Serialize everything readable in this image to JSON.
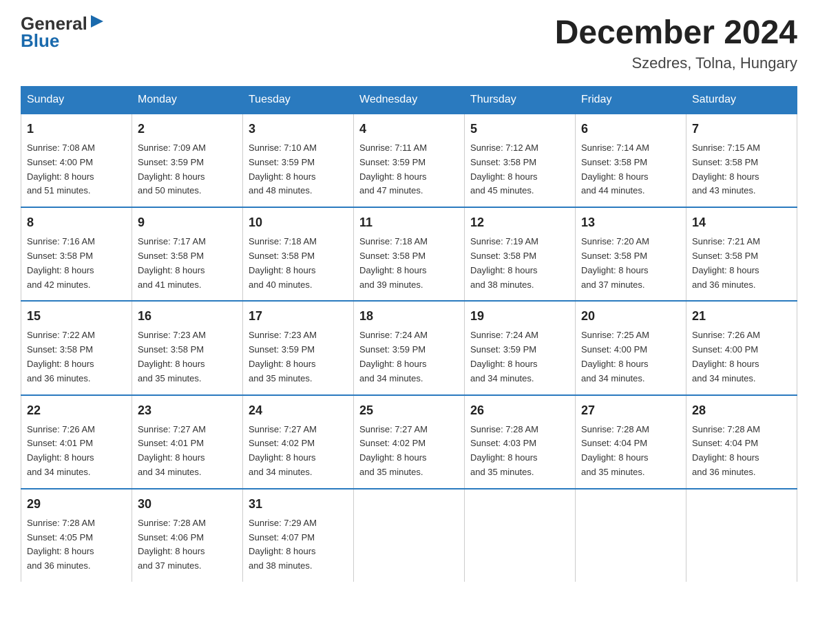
{
  "header": {
    "logo_text_general": "General",
    "logo_text_blue": "Blue",
    "month_title": "December 2024",
    "subtitle": "Szedres, Tolna, Hungary"
  },
  "days_of_week": [
    "Sunday",
    "Monday",
    "Tuesday",
    "Wednesday",
    "Thursday",
    "Friday",
    "Saturday"
  ],
  "weeks": [
    [
      {
        "day": "1",
        "sunrise": "7:08 AM",
        "sunset": "4:00 PM",
        "daylight": "8 hours and 51 minutes."
      },
      {
        "day": "2",
        "sunrise": "7:09 AM",
        "sunset": "3:59 PM",
        "daylight": "8 hours and 50 minutes."
      },
      {
        "day": "3",
        "sunrise": "7:10 AM",
        "sunset": "3:59 PM",
        "daylight": "8 hours and 48 minutes."
      },
      {
        "day": "4",
        "sunrise": "7:11 AM",
        "sunset": "3:59 PM",
        "daylight": "8 hours and 47 minutes."
      },
      {
        "day": "5",
        "sunrise": "7:12 AM",
        "sunset": "3:58 PM",
        "daylight": "8 hours and 45 minutes."
      },
      {
        "day": "6",
        "sunrise": "7:14 AM",
        "sunset": "3:58 PM",
        "daylight": "8 hours and 44 minutes."
      },
      {
        "day": "7",
        "sunrise": "7:15 AM",
        "sunset": "3:58 PM",
        "daylight": "8 hours and 43 minutes."
      }
    ],
    [
      {
        "day": "8",
        "sunrise": "7:16 AM",
        "sunset": "3:58 PM",
        "daylight": "8 hours and 42 minutes."
      },
      {
        "day": "9",
        "sunrise": "7:17 AM",
        "sunset": "3:58 PM",
        "daylight": "8 hours and 41 minutes."
      },
      {
        "day": "10",
        "sunrise": "7:18 AM",
        "sunset": "3:58 PM",
        "daylight": "8 hours and 40 minutes."
      },
      {
        "day": "11",
        "sunrise": "7:18 AM",
        "sunset": "3:58 PM",
        "daylight": "8 hours and 39 minutes."
      },
      {
        "day": "12",
        "sunrise": "7:19 AM",
        "sunset": "3:58 PM",
        "daylight": "8 hours and 38 minutes."
      },
      {
        "day": "13",
        "sunrise": "7:20 AM",
        "sunset": "3:58 PM",
        "daylight": "8 hours and 37 minutes."
      },
      {
        "day": "14",
        "sunrise": "7:21 AM",
        "sunset": "3:58 PM",
        "daylight": "8 hours and 36 minutes."
      }
    ],
    [
      {
        "day": "15",
        "sunrise": "7:22 AM",
        "sunset": "3:58 PM",
        "daylight": "8 hours and 36 minutes."
      },
      {
        "day": "16",
        "sunrise": "7:23 AM",
        "sunset": "3:58 PM",
        "daylight": "8 hours and 35 minutes."
      },
      {
        "day": "17",
        "sunrise": "7:23 AM",
        "sunset": "3:59 PM",
        "daylight": "8 hours and 35 minutes."
      },
      {
        "day": "18",
        "sunrise": "7:24 AM",
        "sunset": "3:59 PM",
        "daylight": "8 hours and 34 minutes."
      },
      {
        "day": "19",
        "sunrise": "7:24 AM",
        "sunset": "3:59 PM",
        "daylight": "8 hours and 34 minutes."
      },
      {
        "day": "20",
        "sunrise": "7:25 AM",
        "sunset": "4:00 PM",
        "daylight": "8 hours and 34 minutes."
      },
      {
        "day": "21",
        "sunrise": "7:26 AM",
        "sunset": "4:00 PM",
        "daylight": "8 hours and 34 minutes."
      }
    ],
    [
      {
        "day": "22",
        "sunrise": "7:26 AM",
        "sunset": "4:01 PM",
        "daylight": "8 hours and 34 minutes."
      },
      {
        "day": "23",
        "sunrise": "7:27 AM",
        "sunset": "4:01 PM",
        "daylight": "8 hours and 34 minutes."
      },
      {
        "day": "24",
        "sunrise": "7:27 AM",
        "sunset": "4:02 PM",
        "daylight": "8 hours and 34 minutes."
      },
      {
        "day": "25",
        "sunrise": "7:27 AM",
        "sunset": "4:02 PM",
        "daylight": "8 hours and 35 minutes."
      },
      {
        "day": "26",
        "sunrise": "7:28 AM",
        "sunset": "4:03 PM",
        "daylight": "8 hours and 35 minutes."
      },
      {
        "day": "27",
        "sunrise": "7:28 AM",
        "sunset": "4:04 PM",
        "daylight": "8 hours and 35 minutes."
      },
      {
        "day": "28",
        "sunrise": "7:28 AM",
        "sunset": "4:04 PM",
        "daylight": "8 hours and 36 minutes."
      }
    ],
    [
      {
        "day": "29",
        "sunrise": "7:28 AM",
        "sunset": "4:05 PM",
        "daylight": "8 hours and 36 minutes."
      },
      {
        "day": "30",
        "sunrise": "7:28 AM",
        "sunset": "4:06 PM",
        "daylight": "8 hours and 37 minutes."
      },
      {
        "day": "31",
        "sunrise": "7:29 AM",
        "sunset": "4:07 PM",
        "daylight": "8 hours and 38 minutes."
      },
      null,
      null,
      null,
      null
    ]
  ],
  "labels": {
    "sunrise": "Sunrise:",
    "sunset": "Sunset:",
    "daylight": "Daylight:"
  }
}
